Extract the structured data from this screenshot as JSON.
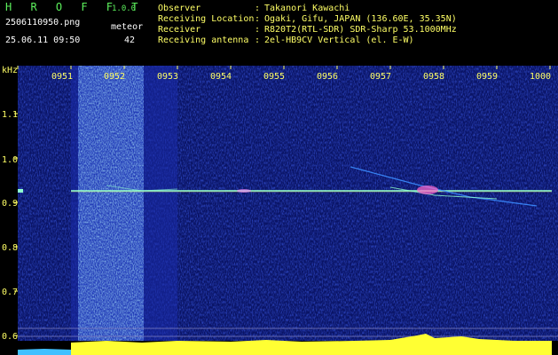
{
  "header": {
    "app_title": "H R O F F T",
    "version": "1.0.0",
    "file_name": "2506110950.png",
    "mode_label": "meteor",
    "date_time": "25.06.11 09:50",
    "count": "42"
  },
  "info": [
    {
      "label": "Observer",
      "value": "Takanori Kawachi"
    },
    {
      "label": "Receiving Location",
      "value": "Ogaki, Gifu, JAPAN (136.60E, 35.35N)"
    },
    {
      "label": "Receiver",
      "value": "R820T2(RTL-SDR) SDR-Sharp 53.1000MHz"
    },
    {
      "label": "Receiving antenna",
      "value": "2el-HB9CV Vertical (el. E-W)"
    }
  ],
  "axis": {
    "unit": "kHz",
    "y_ticks": [
      "1.1",
      "1.0",
      "0.9",
      "0.8",
      "0.7",
      "0.6"
    ],
    "x_ticks": [
      "0951",
      "0952",
      "0953",
      "0954",
      "0955",
      "0956",
      "0957",
      "0958",
      "0959",
      "1000"
    ]
  },
  "colors": {
    "background": "#000000",
    "title_green": "#5cf05c",
    "label_yellow": "#ffff66",
    "spectrum_blue": "#1a2aa0",
    "carrier_cyan": "#8fffd0"
  }
}
